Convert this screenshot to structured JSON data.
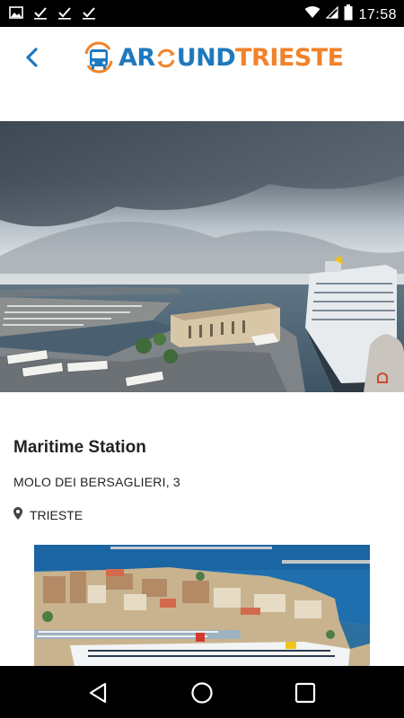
{
  "status_bar": {
    "time": "17:58",
    "icons": [
      "image-icon",
      "check-icon",
      "check-icon",
      "check-icon",
      "wifi-icon",
      "signal-icon",
      "battery-icon"
    ]
  },
  "header": {
    "logo_part1": "AR",
    "logo_part2": "UND",
    "logo_part3": "TRIESTE",
    "back_icon": "chevron-left-icon"
  },
  "place": {
    "title": "Maritime Station",
    "address": "MOLO DEI BERSAGLIERI, 3",
    "city": "TRIESTE",
    "city_icon": "location-pin-icon"
  },
  "navigation": {
    "back": "triangle-back-icon",
    "home": "circle-home-icon",
    "recents": "square-recents-icon"
  },
  "colors": {
    "brand_blue": "#1e79be",
    "brand_orange": "#f2822a"
  }
}
